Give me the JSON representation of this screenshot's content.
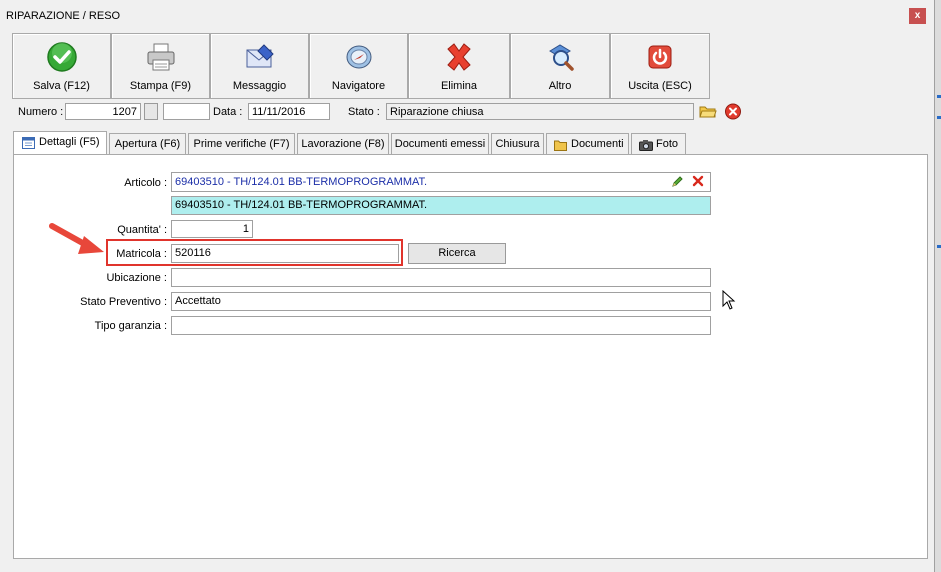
{
  "window": {
    "title": "RIPARAZIONE / RESO",
    "close_glyph": "x"
  },
  "toolbar": [
    {
      "key": "salva",
      "label": "Salva (F12)",
      "icon": "check-icon"
    },
    {
      "key": "stampa",
      "label": "Stampa (F9)",
      "icon": "printer-icon"
    },
    {
      "key": "messaggio",
      "label": "Messaggio",
      "icon": "message-icon"
    },
    {
      "key": "navigatore",
      "label": "Navigatore",
      "icon": "compass-icon"
    },
    {
      "key": "elimina",
      "label": "Elimina",
      "icon": "delete-icon"
    },
    {
      "key": "altro",
      "label": "Altro",
      "icon": "search-document-icon"
    },
    {
      "key": "uscita",
      "label": "Uscita (ESC)",
      "icon": "power-icon"
    }
  ],
  "header": {
    "numero_label": "Numero :",
    "numero_value": "1207",
    "suffix_value": "",
    "data_label": "Data :",
    "data_value": "11/11/2016",
    "stato_label": "Stato :",
    "stato_value": "Riparazione chiusa"
  },
  "tabs": [
    {
      "label": "Dettagli (F5)",
      "icon": "calendar-icon",
      "active": true
    },
    {
      "label": "Apertura (F6)",
      "active": false
    },
    {
      "label": "Prime verifiche (F7)",
      "active": false
    },
    {
      "label": "Lavorazione (F8)",
      "active": false
    },
    {
      "label": "Documenti emessi",
      "active": false
    },
    {
      "label": "Chiusura",
      "active": false
    },
    {
      "label": "Documenti",
      "icon": "folder-icon",
      "active": false
    },
    {
      "label": "Foto",
      "icon": "camera-icon",
      "active": false
    }
  ],
  "form": {
    "articolo_label": "Articolo :",
    "articolo_value": "69403510 - TH/124.01 BB-TERMOPROGRAMMAT.",
    "articolo_desc": "69403510 - TH/124.01 BB-TERMOPROGRAMMAT.",
    "quantita_label": "Quantita' :",
    "quantita_value": "1",
    "matricola_label": "Matricola :",
    "matricola_value": "520116",
    "ricerca_label": "Ricerca",
    "ubicazione_label": "Ubicazione :",
    "ubicazione_value": "",
    "stato_prev_label": "Stato Preventivo :",
    "stato_prev_value": "Accettato",
    "tipo_garanzia_label": "Tipo garanzia :",
    "tipo_garanzia_value": ""
  },
  "colors": {
    "accent_red": "#e0342c",
    "articolo_text": "#1c2fa8",
    "desc_bg": "#aeeeee"
  }
}
